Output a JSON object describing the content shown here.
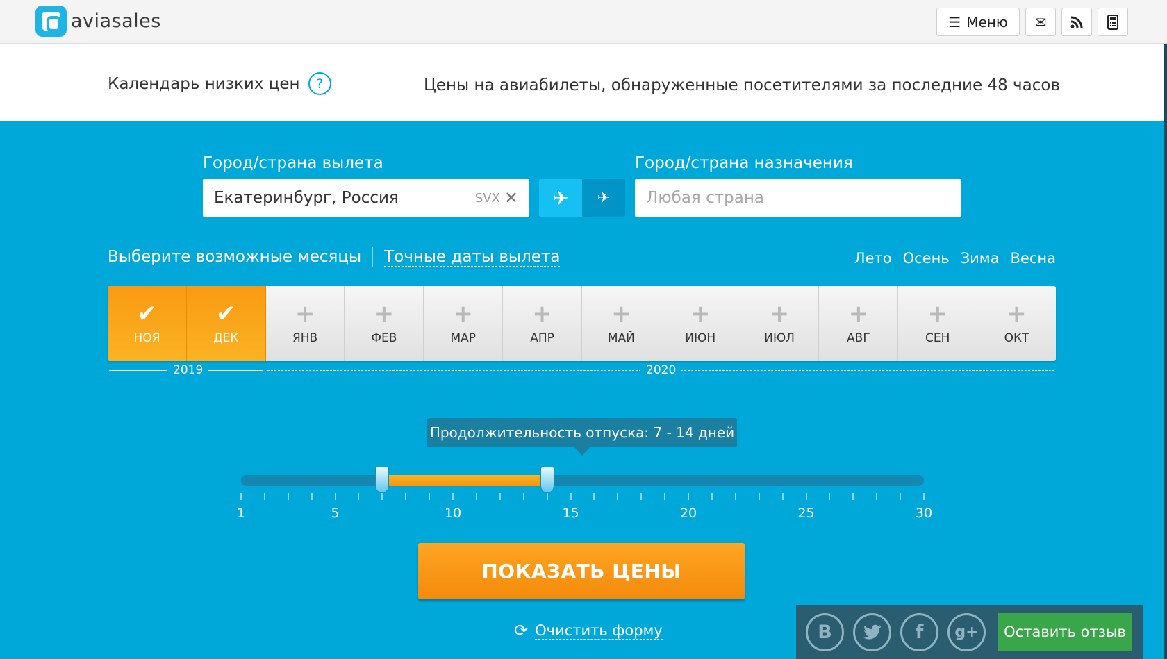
{
  "header": {
    "logo_text": "aviasales",
    "menu_label": "Меню",
    "icons": [
      "list-icon",
      "mail-icon",
      "rss-icon",
      "calculator-icon"
    ]
  },
  "intro": {
    "title": "Календарь низких цен",
    "help": "?",
    "description": "Цены на авиабилеты, обнаруженные посетителями за последние 48 часов"
  },
  "form": {
    "origin_label": "Город/страна вылета",
    "origin_value": "Екатеринбург, Россия",
    "origin_code": "SVX",
    "destination_label": "Город/страна назначения",
    "destination_placeholder": "Любая страна"
  },
  "months_section": {
    "choose_label": "Выберите возможные месяцы",
    "exact_dates_link": "Точные даты вылета",
    "seasons": [
      "Лето",
      "Осень",
      "Зима",
      "Весна"
    ],
    "months": [
      {
        "label": "НОЯ",
        "selected": true
      },
      {
        "label": "ДЕК",
        "selected": true
      },
      {
        "label": "ЯНВ",
        "selected": false
      },
      {
        "label": "ФЕВ",
        "selected": false
      },
      {
        "label": "МАР",
        "selected": false
      },
      {
        "label": "АПР",
        "selected": false
      },
      {
        "label": "МАЙ",
        "selected": false
      },
      {
        "label": "ИЮН",
        "selected": false
      },
      {
        "label": "ИЮЛ",
        "selected": false
      },
      {
        "label": "АВГ",
        "selected": false
      },
      {
        "label": "СЕН",
        "selected": false
      },
      {
        "label": "ОКТ",
        "selected": false
      }
    ],
    "years": [
      "2019",
      "2020"
    ]
  },
  "duration": {
    "tooltip": "Продолжительность отпуска: 7 - 14 дней",
    "min": 1,
    "max": 30,
    "range_from": 7,
    "range_to": 14,
    "tick_labels": [
      "1",
      "5",
      "10",
      "15",
      "20",
      "25",
      "30"
    ]
  },
  "actions": {
    "show_prices": "ПОКАЗАТЬ ЦЕНЫ",
    "clear_form": "Очистить форму"
  },
  "social": {
    "networks": [
      "vk-icon",
      "twitter-icon",
      "facebook-icon",
      "google-plus-icon"
    ],
    "feedback_label": "Оставить отзыв"
  },
  "colors": {
    "accent": "#00a7d9",
    "orange": "#f7941d",
    "green": "#3aa64a"
  }
}
